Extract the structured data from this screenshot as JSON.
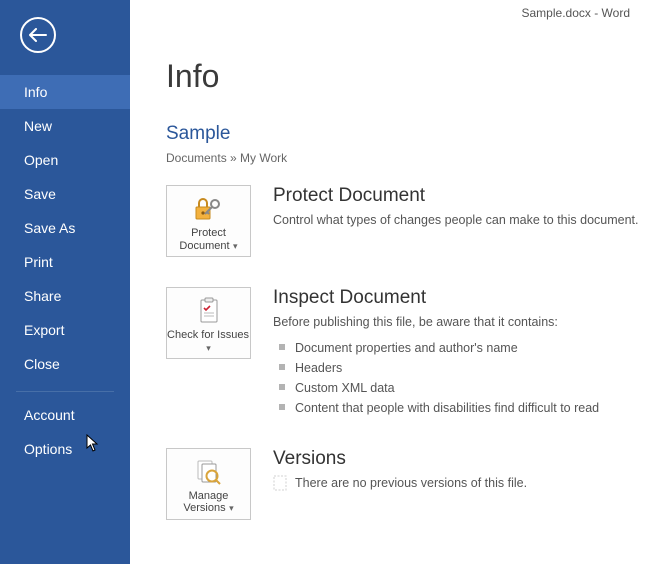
{
  "titlebar": "Sample.docx - Word",
  "sidebar": {
    "items": [
      {
        "label": "Info"
      },
      {
        "label": "New"
      },
      {
        "label": "Open"
      },
      {
        "label": "Save"
      },
      {
        "label": "Save As"
      },
      {
        "label": "Print"
      },
      {
        "label": "Share"
      },
      {
        "label": "Export"
      },
      {
        "label": "Close"
      }
    ],
    "bottom": [
      {
        "label": "Account"
      },
      {
        "label": "Options"
      }
    ]
  },
  "page": {
    "title": "Info",
    "docname": "Sample",
    "breadcrumb": "Documents » My Work"
  },
  "protect": {
    "tile": "Protect Document",
    "title": "Protect Document",
    "desc": "Control what types of changes people can make to this document."
  },
  "inspect": {
    "tile": "Check for Issues",
    "title": "Inspect Document",
    "desc": "Before publishing this file, be aware that it contains:",
    "items": [
      "Document properties and author's name",
      "Headers",
      "Custom XML data",
      "Content that people with disabilities find difficult to read"
    ]
  },
  "versions": {
    "tile": "Manage Versions",
    "title": "Versions",
    "desc": "There are no previous versions of this file."
  }
}
